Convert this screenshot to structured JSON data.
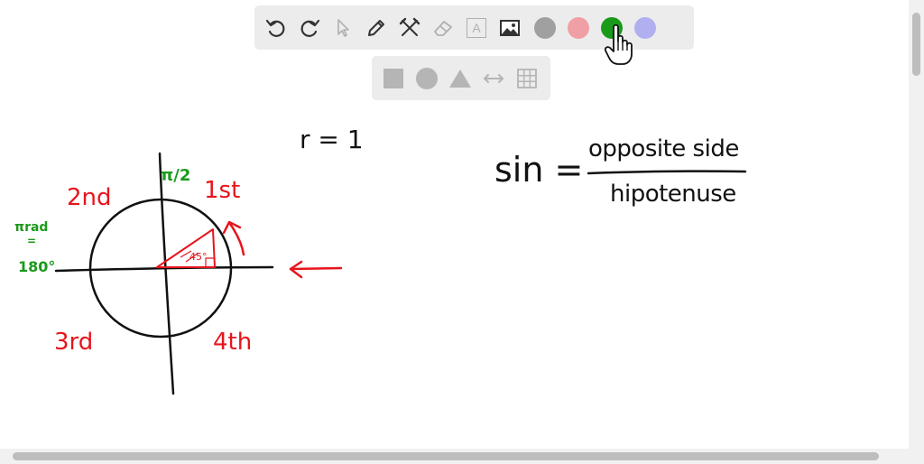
{
  "toolbar": {
    "tools": [
      "undo",
      "redo",
      "select",
      "pen",
      "tools",
      "eraser",
      "text",
      "image"
    ],
    "text_tool_label": "A",
    "colors": [
      {
        "name": "gray",
        "hex": "#a0a0a0"
      },
      {
        "name": "pink",
        "hex": "#f0a0a4"
      },
      {
        "name": "green",
        "hex": "#1a9a1a"
      },
      {
        "name": "lavender",
        "hex": "#b0b0f0"
      }
    ],
    "selected_color": "green"
  },
  "shape_toolbar": {
    "tools": [
      "square",
      "circle",
      "triangle",
      "double-arrow",
      "grid"
    ]
  },
  "board": {
    "radius_note": "r = 1",
    "formula": {
      "lhs": "sin =",
      "numerator": "opposite side",
      "denominator": "hipotenuse"
    },
    "quadrants": {
      "first": "1st",
      "second": "2nd",
      "third": "3rd",
      "fourth": "4th"
    },
    "top_angle": "π/2",
    "left_angle_top": "πrad",
    "left_angle_eq": "=",
    "left_angle_bottom": "180°",
    "triangle_angle": "45°"
  },
  "colors": {
    "ink_black": "#111111",
    "ink_red": "#e8141c",
    "ink_green": "#1c9a1c"
  }
}
